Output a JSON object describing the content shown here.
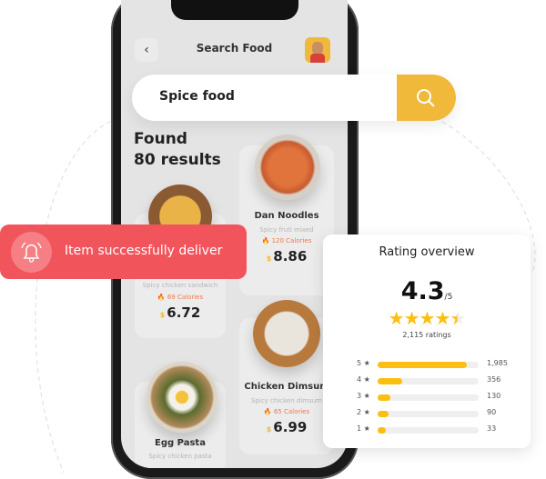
{
  "header": {
    "title": "Search Food",
    "back_icon": "chevron-left-icon"
  },
  "search": {
    "value": "Spice food",
    "button_icon": "search-icon",
    "accent": "#f0b93a"
  },
  "results": {
    "line1": "Found",
    "line2": "80 results"
  },
  "foods": [
    {
      "name": "",
      "desc": "Spicy chicken sandwich",
      "calories": "69 Calories",
      "currency": "$",
      "price": "6.72"
    },
    {
      "name": "Dan Noodles",
      "desc": "Spicy fruti mixed",
      "calories": "120 Calories",
      "currency": "$",
      "price": "8.86"
    },
    {
      "name": "Chicken Dimsum",
      "desc": "Spicy chicken dimsum",
      "calories": "65 Calories",
      "currency": "$",
      "price": "6.99"
    },
    {
      "name": "Egg Pasta",
      "desc": "Spicy chicken pasta"
    }
  ],
  "toast": {
    "text": "Item successfully deliver",
    "icon": "bell-icon",
    "color": "#f2545b"
  },
  "rating": {
    "title": "Rating overview",
    "score": "4.3",
    "out_of": "/5",
    "stars": 4.3,
    "count": "2,115 ratings",
    "rows": [
      {
        "label": "5",
        "count": "1,985",
        "pct": 88
      },
      {
        "label": "4",
        "count": "356",
        "pct": 24
      },
      {
        "label": "3",
        "count": "130",
        "pct": 13
      },
      {
        "label": "2",
        "count": "90",
        "pct": 11
      },
      {
        "label": "1",
        "count": "33",
        "pct": 8
      }
    ]
  }
}
